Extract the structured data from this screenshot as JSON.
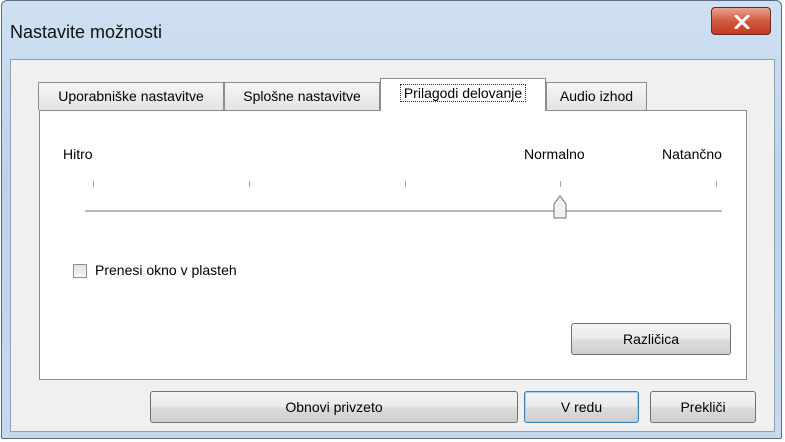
{
  "window": {
    "title": "Nastavite možnosti"
  },
  "tabs": [
    {
      "label": "Uporabniške nastavitve",
      "active": false
    },
    {
      "label": "Splošne nastavitve",
      "active": false
    },
    {
      "label": "Prilagodi delovanje",
      "active": true
    },
    {
      "label": "Audio izhod",
      "active": false
    }
  ],
  "slider": {
    "labels": {
      "left": "Hitro",
      "middle": "Normalno",
      "right": "Natančno"
    },
    "tick_count": 5,
    "position_index": 3
  },
  "checkbox": {
    "label": "Prenesi okno v plasteh",
    "checked": false
  },
  "version_button": {
    "label": "Različica"
  },
  "footer": {
    "restore_label": "Obnovi privzeto",
    "ok_label": "V redu",
    "cancel_label": "Prekliči"
  },
  "colors": {
    "close_button": "#c23a22",
    "title_bar": "#bcd3ea",
    "default_button_border": "#3c7fb1"
  },
  "icons": {
    "close": "close-x-icon",
    "slider_thumb": "slider-thumb-icon"
  }
}
